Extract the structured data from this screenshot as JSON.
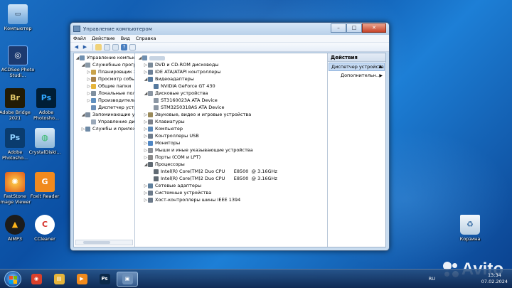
{
  "desktop": {
    "icons": [
      {
        "label": "Компьютер",
        "icon": "computer-icon"
      },
      {
        "label": "ACDSee Photo Studi...",
        "icon": "acdsee-icon"
      },
      {
        "label": "Adobe Bridge 2021",
        "icon": "bridge-icon"
      },
      {
        "label": "Adobe Photosho...",
        "icon": "photoshop-icon"
      },
      {
        "label": "Adobe Photosho...",
        "icon": "photoshop-icon"
      },
      {
        "label": "CrystalDiskI...",
        "icon": "crystaldisk-icon"
      },
      {
        "label": "FastStone Image Viewer",
        "icon": "faststone-icon"
      },
      {
        "label": "Foxit Reader",
        "icon": "foxit-icon"
      },
      {
        "label": "AIMP3",
        "icon": "aimp-icon"
      },
      {
        "label": "CCleaner",
        "icon": "ccleaner-icon"
      },
      {
        "label": "Корзина",
        "icon": "recycle-bin-icon"
      }
    ]
  },
  "window": {
    "title": "Управление компьютером",
    "controls": {
      "minimize": "–",
      "maximize": "□",
      "close": "✕"
    },
    "menu": [
      "Файл",
      "Действие",
      "Вид",
      "Справка"
    ],
    "left_tree": [
      {
        "label": "Управление компьютер",
        "level": 0,
        "exp": "◢"
      },
      {
        "label": "Служебные програм",
        "level": 1,
        "exp": "◢"
      },
      {
        "label": "Планировщик зад",
        "level": 2,
        "exp": "▷"
      },
      {
        "label": "Просмотр событи",
        "level": 2,
        "exp": "▷"
      },
      {
        "label": "Общие папки",
        "level": 2,
        "exp": "▷"
      },
      {
        "label": "Локальные польз",
        "level": 2,
        "exp": "▷"
      },
      {
        "label": "Производительн",
        "level": 2,
        "exp": "▷"
      },
      {
        "label": "Диспетчер устрой",
        "level": 2,
        "exp": ""
      },
      {
        "label": "Запоминающие устр",
        "level": 1,
        "exp": "◢"
      },
      {
        "label": "Управление диска",
        "level": 2,
        "exp": ""
      },
      {
        "label": "Службы и приложен",
        "level": 1,
        "exp": "▷"
      }
    ],
    "device_tree": [
      {
        "label": "",
        "level": 0,
        "exp": "◢",
        "color": "#6f8fb0"
      },
      {
        "label": "DVD и CD-ROM дисководы",
        "level": 1,
        "exp": "▷",
        "color": "#7a8a99"
      },
      {
        "label": "IDE ATA/ATAPI контроллеры",
        "level": 1,
        "exp": "▷",
        "color": "#6c7f96"
      },
      {
        "label": "Видеоадаптеры",
        "level": 1,
        "exp": "◢",
        "color": "#55799e"
      },
      {
        "label": "NVIDIA GeForce GT 430",
        "level": 2,
        "exp": "",
        "color": "#55799e"
      },
      {
        "label": "Дисковые устройства",
        "level": 1,
        "exp": "◢",
        "color": "#8b96a3"
      },
      {
        "label": "ST3160023A ATA Device",
        "level": 2,
        "exp": "",
        "color": "#8b96a3"
      },
      {
        "label": "STM3250318AS ATA Device",
        "level": 2,
        "exp": "",
        "color": "#8b96a3"
      },
      {
        "label": "Звуковые, видео и игровые устройства",
        "level": 1,
        "exp": "▷",
        "color": "#9a8a5a"
      },
      {
        "label": "Клавиатуры",
        "level": 1,
        "exp": "▷",
        "color": "#7a7f88"
      },
      {
        "label": "Компьютер",
        "level": 1,
        "exp": "▷",
        "color": "#5a88b8"
      },
      {
        "label": "Контроллеры USB",
        "level": 1,
        "exp": "▷",
        "color": "#6e7c8c"
      },
      {
        "label": "Мониторы",
        "level": 1,
        "exp": "▷",
        "color": "#4f86c3"
      },
      {
        "label": "Мыши и иные указывающие устройства",
        "level": 1,
        "exp": "▷",
        "color": "#8a8f96"
      },
      {
        "label": "Порты (COM и LPT)",
        "level": 1,
        "exp": "▷",
        "color": "#8a8a8a"
      },
      {
        "label": "Процессоры",
        "level": 1,
        "exp": "◢",
        "color": "#606a73"
      },
      {
        "label": "Intel(R) Core(TM)2 Duo CPU      E8500  @ 3.16GHz",
        "level": 2,
        "exp": "",
        "color": "#606a73"
      },
      {
        "label": "Intel(R) Core(TM)2 Duo CPU      E8500  @ 3.16GHz",
        "level": 2,
        "exp": "",
        "color": "#606a73"
      },
      {
        "label": "Сетевые адаптеры",
        "level": 1,
        "exp": "▷",
        "color": "#5f7f9c"
      },
      {
        "label": "Системные устройства",
        "level": 1,
        "exp": "▷",
        "color": "#6c7a8a"
      },
      {
        "label": "Хост-контроллеры шины IEEE 1394",
        "level": 1,
        "exp": "▷",
        "color": "#6c7a8a"
      }
    ],
    "actions": {
      "header": "Действия",
      "selected": "Диспетчер устройств",
      "item": "Дополнительн..."
    }
  },
  "taskbar": {
    "apps": [
      {
        "icon": "chrome-icon",
        "color": "#d9402b",
        "glyph": "◉"
      },
      {
        "icon": "explorer-icon",
        "color": "#e6b43a",
        "glyph": "▤"
      },
      {
        "icon": "media-player-icon",
        "color": "#f08a1c",
        "glyph": "▶"
      },
      {
        "icon": "photoshop-icon",
        "color": "#0b2a4a",
        "glyph": "Ps"
      },
      {
        "icon": "computer-management-icon",
        "color": "#6c8fb8",
        "glyph": "▣"
      }
    ],
    "language": "RU",
    "time": "13:34",
    "date": "07.02.2024"
  },
  "watermark": "Avito"
}
